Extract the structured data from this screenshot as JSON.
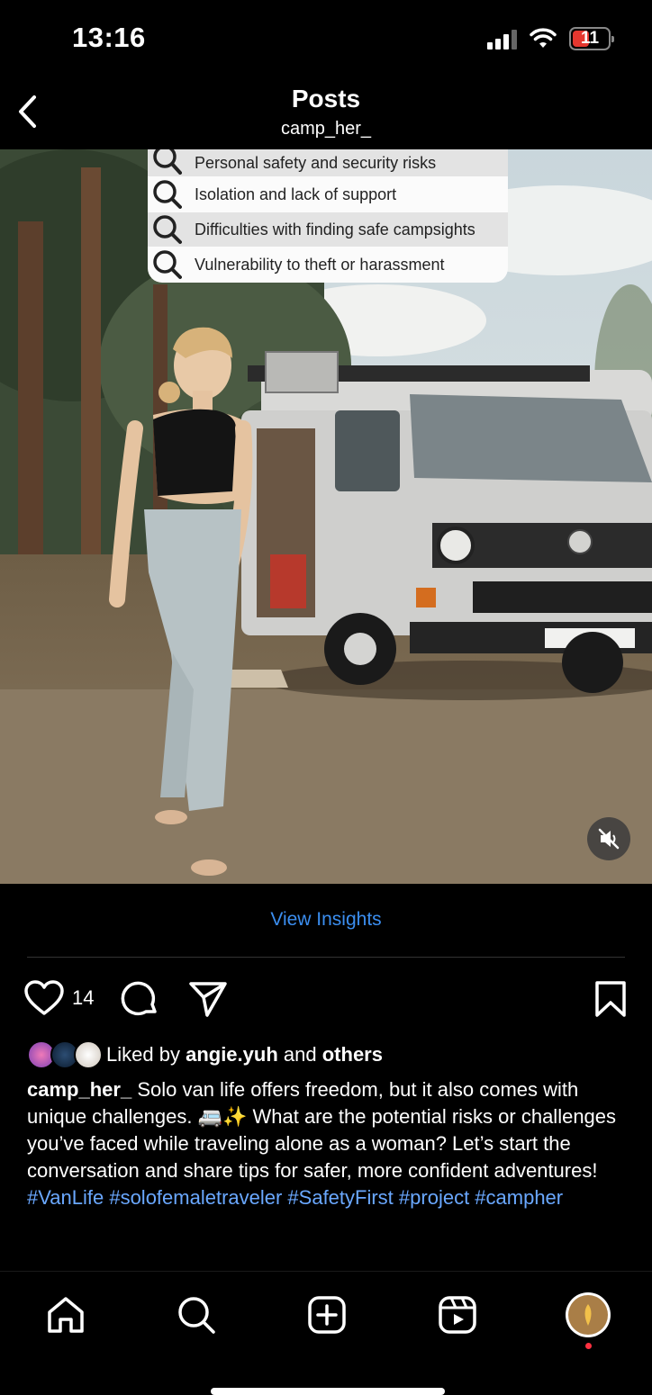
{
  "status_bar": {
    "time": "13:16",
    "battery": "11"
  },
  "header": {
    "title": "Posts",
    "subtitle": "camp_her_"
  },
  "overlay": {
    "rows": [
      "Personal safety and security risks",
      "Isolation and lack of support",
      "Difficulties with finding safe campsights",
      "Vulnerability to theft or harassment"
    ]
  },
  "insights_label": "View Insights",
  "actions": {
    "like_count": "14"
  },
  "likes": {
    "prefix": "Liked by",
    "user": "angie.yuh",
    "and": "and",
    "others": "others"
  },
  "caption": {
    "username": "camp_her_",
    "text": "Solo van life offers freedom, but it also comes with unique challenges. 🚐✨  What are the potential risks or challenges you’ve faced while traveling alone as a woman? Let’s start the conversation and share tips for safer, more confident adventures!",
    "hashtags": "#VanLife #solofemaletraveler #SafetyFirst #project #campher"
  },
  "colors": {
    "link": "#3b8ef0",
    "hashtag": "#6aa8ff",
    "battery_low": "#e5372f"
  }
}
